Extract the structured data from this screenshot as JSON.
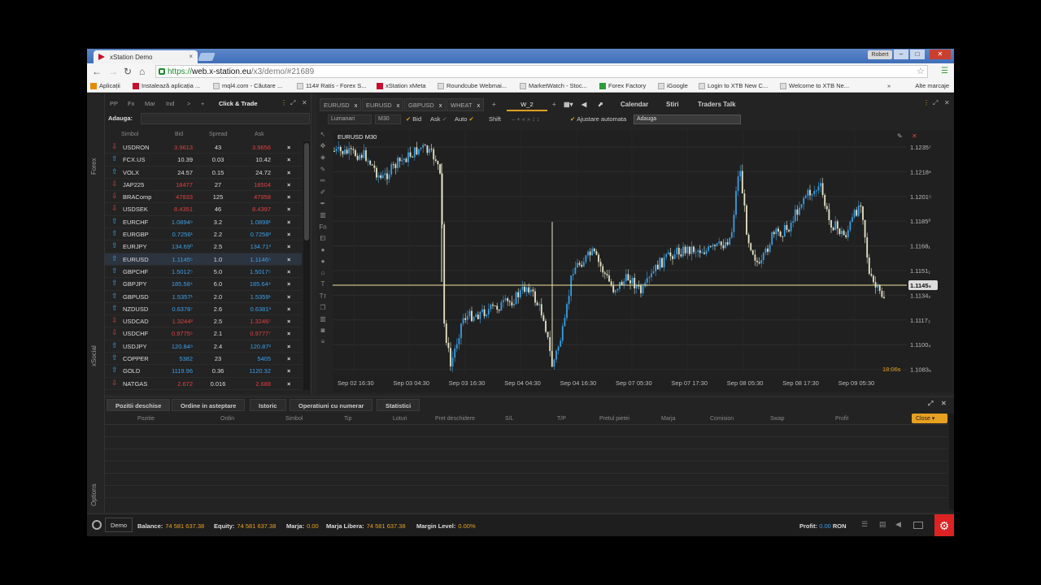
{
  "browser": {
    "tab_title": "xStation Demo",
    "tab_close": "×",
    "user": "Robert",
    "url_scheme": "https://",
    "url_host": "web.x-station.eu",
    "url_path": "/x3/demo/#21689",
    "bookmarks": [
      "Aplicații",
      "Instalează aplicația ...",
      "mql4.com - Căutare ...",
      "114# Ratis - Forex S...",
      "xStation xMeta",
      "Roundcube Webmai...",
      "MarketWatch - Stoc...",
      "Forex Factory",
      "iGoogle",
      "Login to XTB New C...",
      "Welcome to XTB Ne..."
    ],
    "more": "»",
    "other_bookmarks": "Alte marcaje"
  },
  "rail": {
    "forex": "Forex",
    "xsocial": "xSocial",
    "options": "Options"
  },
  "market_watch": {
    "tabs": [
      "PP",
      "Fx",
      "Mar",
      "Ind",
      ">",
      "+"
    ],
    "click_trade": "Click & Trade",
    "add_label": "Adauga:",
    "columns": [
      "Simbol",
      "Bid",
      "Spread",
      "Ask"
    ],
    "rows": [
      {
        "symbol": "USDRON",
        "bid": "3.9613",
        "spread": "43",
        "ask": "3.9656",
        "dir": "down"
      },
      {
        "symbol": "FCX.US",
        "bid": "10.39",
        "spread": "0.03",
        "ask": "10.42",
        "dir": "flat"
      },
      {
        "symbol": "VOLX",
        "bid": "24.57",
        "spread": "0.15",
        "ask": "24.72",
        "dir": "flat"
      },
      {
        "symbol": "JAP225",
        "bid": "18477",
        "spread": "27",
        "ask": "18504",
        "dir": "down"
      },
      {
        "symbol": "BRAComp",
        "bid": "47833",
        "spread": "125",
        "ask": "47958",
        "dir": "down"
      },
      {
        "symbol": "USDSEK",
        "bid": "8.4351",
        "spread": "46",
        "ask": "8.4397",
        "dir": "down"
      },
      {
        "symbol": "EURCHF",
        "bid": "1.0894⁹",
        "spread": "3.2",
        "ask": "1.0898¹",
        "dir": "up"
      },
      {
        "symbol": "EURGBP",
        "bid": "0.7256¹",
        "spread": "2.2",
        "ask": "0.7258³",
        "dir": "up"
      },
      {
        "symbol": "EURJPY",
        "bid": "134.69⁰",
        "spread": "2.5",
        "ask": "134.71³",
        "dir": "up"
      },
      {
        "symbol": "EURUSD",
        "bid": "1.1145⁵",
        "spread": "1.0",
        "ask": "1.1146⁵",
        "dir": "up"
      },
      {
        "symbol": "GBPCHF",
        "bid": "1.5012⁵",
        "spread": "5.0",
        "ask": "1.5017⁵",
        "dir": "up"
      },
      {
        "symbol": "GBPJPY",
        "bid": "185.58⁴",
        "spread": "6.0",
        "ask": "185.64⁴",
        "dir": "up"
      },
      {
        "symbol": "GBPUSD",
        "bid": "1.5357¹",
        "spread": "2.0",
        "ask": "1.5359¹",
        "dir": "up"
      },
      {
        "symbol": "NZDUSD",
        "bid": "0.6378⁷",
        "spread": "2.6",
        "ask": "0.6381³",
        "dir": "up"
      },
      {
        "symbol": "USDCAD",
        "bid": "1.3244²",
        "spread": "2.5",
        "ask": "1.3246⁷",
        "dir": "down"
      },
      {
        "symbol": "USDCHF",
        "bid": "0.9775⁶",
        "spread": "2.1",
        "ask": "0.9777⁷",
        "dir": "down"
      },
      {
        "symbol": "USDJPY",
        "bid": "120.84⁸",
        "spread": "2.4",
        "ask": "120.87²",
        "dir": "up"
      },
      {
        "symbol": "COPPER",
        "bid": "5382",
        "spread": "23",
        "ask": "5405",
        "dir": "up"
      },
      {
        "symbol": "GOLD",
        "bid": "1119.96",
        "spread": "0.36",
        "ask": "1120.32",
        "dir": "up"
      },
      {
        "symbol": "NATGAS",
        "bid": "2.672",
        "spread": "0.016",
        "ask": "2.688",
        "dir": "down"
      }
    ]
  },
  "chart": {
    "tabs": [
      "EURUSD",
      "EURUSD",
      "GBPUSD",
      "WHEAT"
    ],
    "active_layout": "W_2",
    "top_buttons": [
      "Calendar",
      "Stiri",
      "Traders Talk"
    ],
    "chart_type": "Lumanari",
    "timeframe": "M30",
    "options": [
      "Bid",
      "Ask",
      "Auto",
      "Shift"
    ],
    "auto_adjust": "Ajustare automata",
    "add_placeholder": "Adauga",
    "label": "EURUSD M30",
    "price_labels": [
      "1.1235⁷",
      "1.1218⁶",
      "1.1201⁵",
      "1.1185⁰",
      "1.1168₁",
      "1.1151₁",
      "1.1134₂",
      "1.1117₃",
      "1.1100₄",
      "1.1083₅"
    ],
    "current_price": "1.1145₅",
    "time_labels": [
      "Sep 02 16:30",
      "Sep 03 04:30",
      "Sep 03 16:30",
      "Sep 04 04:30",
      "Sep 04 16:30",
      "Sep 07 05:30",
      "Sep 07 17:30",
      "Sep 08 05:30",
      "Sep 08 17:30",
      "Sep 09 05:30"
    ],
    "countdown": "18:06s",
    "candle_up_color": "#3a9ee4",
    "candle_down_color": "#e8e6c8"
  },
  "bottom": {
    "tabs": [
      "Pozitii deschise",
      "Ordine in asteptare",
      "Istoric",
      "Operatiuni cu numerar",
      "Statistici"
    ],
    "columns": [
      "Pozitie",
      "Ordin",
      "Simbol",
      "Tip",
      "Loturi",
      "Pret deschidere",
      "S/L",
      "T/P",
      "Pretul pietei",
      "Marja",
      "Comision",
      "Swap",
      "Profit"
    ],
    "close_button": "Close ▾"
  },
  "status": {
    "mode": "Demo",
    "balance_label": "Balance:",
    "balance": "74 581 637.38",
    "equity_label": "Equity:",
    "equity": "74 581 637.38",
    "margin_label": "Marja:",
    "margin": "0.00",
    "free_margin_label": "Marja Libera:",
    "free_margin": "74 581 637.38",
    "margin_level_label": "Margin Level:",
    "margin_level": "0.00%",
    "profit_label": "Profit:",
    "profit": "0.00",
    "currency": "RON"
  }
}
